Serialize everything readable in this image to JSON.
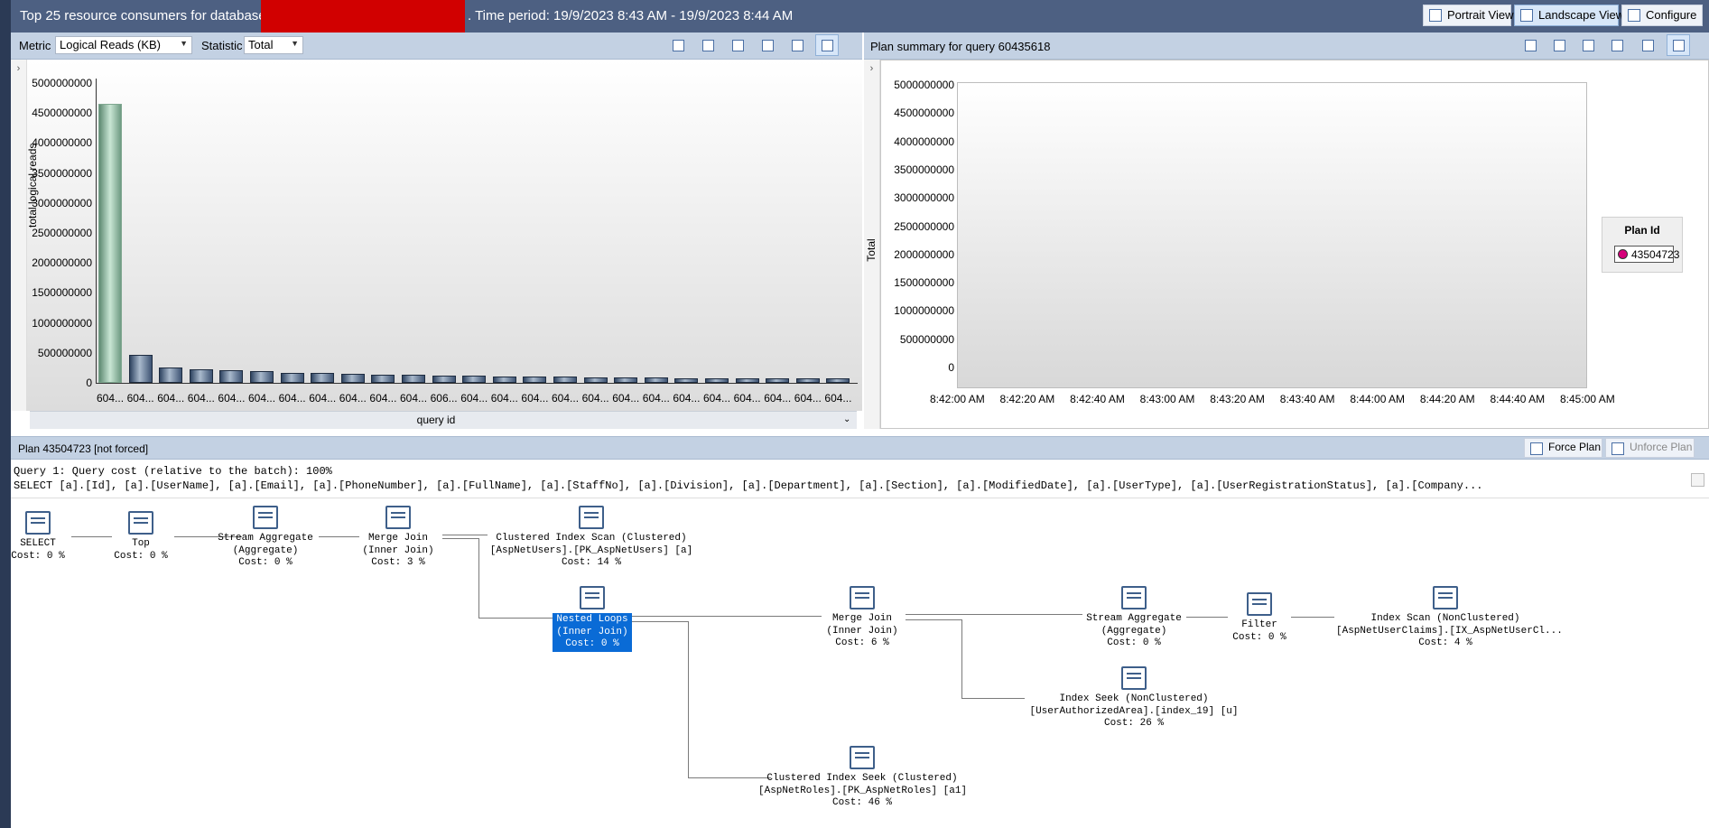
{
  "header": {
    "title_prefix": "Top 25 resource consumers for database",
    "title_suffix": ". Time period: 19/9/2023 8:43 AM - 19/9/2023 8:44 AM",
    "views": [
      "Portrait View",
      "Landscape View",
      "Configure"
    ]
  },
  "left_toolbar": {
    "metric_label": "Metric",
    "metric_value": "Logical Reads (KB)",
    "statistic_label": "Statistic",
    "statistic_value": "Total"
  },
  "right_toolbar": {
    "title": "Plan summary for query 60435618"
  },
  "plan_bar": {
    "title": "Plan 43504723 [not forced]",
    "force_plan": "Force Plan",
    "unforce_plan": "Unforce Plan"
  },
  "query_text": {
    "line1": "Query 1: Query cost (relative to the batch): 100%",
    "line2": "SELECT [a].[Id], [a].[UserName], [a].[Email], [a].[PhoneNumber], [a].[FullName], [a].[StaffNo], [a].[Division], [a].[Department], [a].[Section], [a].[ModifiedDate], [a].[UserType], [a].[UserRegistrationStatus], [a].[Company..."
  },
  "chart_data": [
    {
      "type": "bar",
      "ylabel": "total logical reads",
      "xlabel": "query id",
      "y_ticks": [
        "5000000000",
        "4500000000",
        "4000000000",
        "3500000000",
        "3000000000",
        "2500000000",
        "2000000000",
        "1500000000",
        "1000000000",
        "500000000",
        "0"
      ],
      "ylim": [
        0,
        5000000000
      ],
      "categories": [
        "604...",
        "604...",
        "604...",
        "604...",
        "604...",
        "604...",
        "604...",
        "604...",
        "604...",
        "604...",
        "604...",
        "606...",
        "604...",
        "604...",
        "604...",
        "604...",
        "604...",
        "604...",
        "604...",
        "604...",
        "604...",
        "604...",
        "604...",
        "604...",
        "604..."
      ],
      "values": [
        4650000000,
        470000000,
        250000000,
        230000000,
        210000000,
        190000000,
        170000000,
        160000000,
        150000000,
        140000000,
        130000000,
        120000000,
        115000000,
        110000000,
        105000000,
        100000000,
        95000000,
        90000000,
        85000000,
        80000000,
        78000000,
        75000000,
        72000000,
        70000000,
        68000000
      ],
      "selected_index": 0
    },
    {
      "type": "scatter",
      "ylabel": "Total",
      "y_ticks": [
        "5000000000",
        "4500000000",
        "4000000000",
        "3500000000",
        "3000000000",
        "2500000000",
        "2000000000",
        "1500000000",
        "1000000000",
        "500000000",
        "0"
      ],
      "ylim": [
        0,
        5000000000
      ],
      "x_ticks": [
        "8:42:00 AM",
        "8:42:20 AM",
        "8:42:40 AM",
        "8:43:00 AM",
        "8:43:20 AM",
        "8:43:40 AM",
        "8:44:00 AM",
        "8:44:20 AM",
        "8:44:40 AM",
        "8:45:00 AM"
      ],
      "legend_title": "Plan Id",
      "legend_placement": "right",
      "series": [
        {
          "name": "43504723",
          "color": "#d6007a",
          "points": []
        }
      ]
    }
  ],
  "plan_nodes": {
    "select": {
      "l1": "SELECT",
      "l2": "Cost: 0 %"
    },
    "top": {
      "l1": "Top",
      "l2": "Cost: 0 %"
    },
    "stream_agg1": {
      "l1": "Stream Aggregate",
      "l2": "(Aggregate)",
      "l3": "Cost: 0 %"
    },
    "merge_join1": {
      "l1": "Merge Join",
      "l2": "(Inner Join)",
      "l3": "Cost: 3 %"
    },
    "ci_scan": {
      "l1": "Clustered Index Scan (Clustered)",
      "l2": "[AspNetUsers].[PK_AspNetUsers] [a]",
      "l3": "Cost: 14 %"
    },
    "nested_loops": {
      "l1": "Nested Loops",
      "l2": "(Inner Join)",
      "l3": "Cost: 0 %"
    },
    "merge_join2": {
      "l1": "Merge Join",
      "l2": "(Inner Join)",
      "l3": "Cost: 6 %"
    },
    "stream_agg2": {
      "l1": "Stream Aggregate",
      "l2": "(Aggregate)",
      "l3": "Cost: 0 %"
    },
    "filter": {
      "l1": "Filter",
      "l2": "Cost: 0 %"
    },
    "index_scan": {
      "l1": "Index Scan (NonClustered)",
      "l2": "[AspNetUserClaims].[IX_AspNetUserCl...",
      "l3": "Cost: 4 %"
    },
    "index_seek": {
      "l1": "Index Seek (NonClustered)",
      "l2": "[UserAuthorizedArea].[index_19] [u]",
      "l3": "Cost: 26 %"
    },
    "ci_seek": {
      "l1": "Clustered Index Seek (Clustered)",
      "l2": "[AspNetRoles].[PK_AspNetRoles] [a1]",
      "l3": "Cost: 46 %"
    }
  }
}
